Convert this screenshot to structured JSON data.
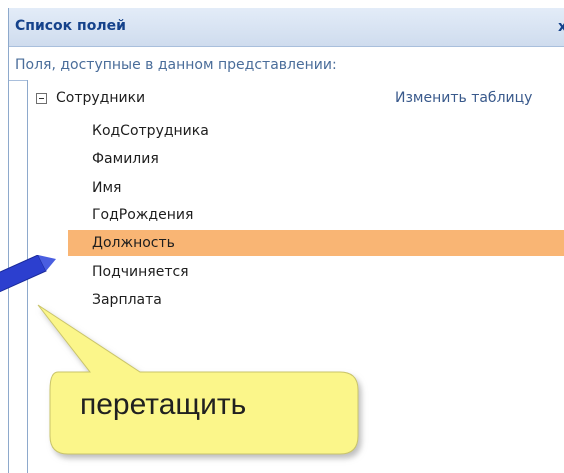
{
  "pane": {
    "title": "Список полей",
    "close_glyph": "x",
    "subtitle": "Поля, доступные в данном представлении:",
    "edit_table_label": "Изменить таблицу"
  },
  "table": {
    "name": "Сотрудники",
    "fields": [
      "КодСотрудника",
      "Фамилия",
      "Имя",
      "ГодРождения",
      "Должность",
      "Подчиняется",
      "Зарплата"
    ],
    "selected_field": "Должность"
  },
  "callout": {
    "label": "перетащить"
  },
  "colors": {
    "selection": "#f9b574",
    "header_text": "#15428b",
    "callout_fill": "#fbf68a",
    "pencil": "#2c3fcf"
  },
  "icons": {
    "expander": "minus-box-icon",
    "pointer": "pencil-icon"
  }
}
